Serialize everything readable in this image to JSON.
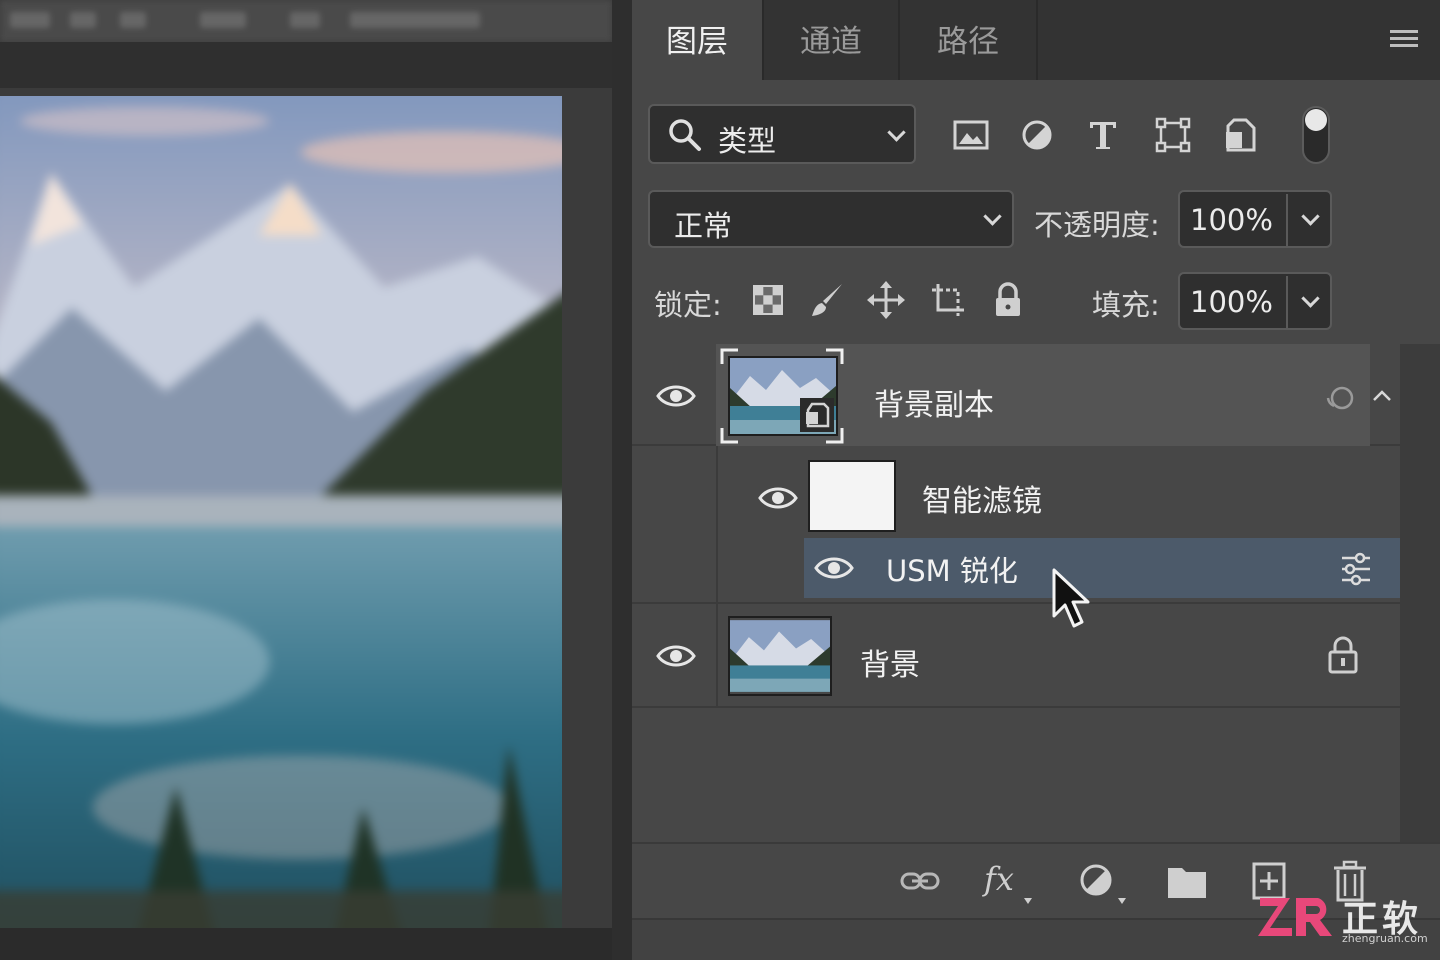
{
  "layers_panel": {
    "tabs": [
      {
        "label": "图层",
        "active": true
      },
      {
        "label": "通道",
        "active": false
      },
      {
        "label": "路径",
        "active": false
      }
    ],
    "filter": {
      "kind_label": "类型",
      "icons": [
        "image-filter-icon",
        "adjustment-filter-icon",
        "type-filter-icon",
        "shape-filter-icon",
        "smart-object-filter-icon"
      ]
    },
    "blend_mode": "正常",
    "opacity_label": "不透明度:",
    "opacity_value": "100%",
    "lock_label": "锁定:",
    "lock_icons": [
      "lock-transparent-pixels-icon",
      "lock-image-pixels-icon",
      "lock-position-icon",
      "lock-artboard-icon",
      "lock-all-icon"
    ],
    "fill_label": "填充:",
    "fill_value": "100%",
    "layers": [
      {
        "name": "背景副本",
        "visible": true,
        "smart_object": true,
        "selected": false
      },
      {
        "name": "智能滤镜",
        "visible": true,
        "type": "smart-filters"
      },
      {
        "name": "USM 锐化",
        "visible": true,
        "type": "filter",
        "highlighted": true
      },
      {
        "name": "背景",
        "visible": true,
        "locked": true
      }
    ],
    "footer_icons": [
      "link-layers-icon",
      "fx-icon",
      "new-adjustment-icon",
      "new-group-icon",
      "new-layer-icon",
      "delete-layer-icon"
    ]
  },
  "watermark": {
    "brand": "正软",
    "domain": "zhengruan.com"
  },
  "colors": {
    "panel_bg": "#474747",
    "tab_bar_bg": "#333333",
    "field_bg": "#2f2f2f",
    "highlight_row": "#4c5a6a"
  }
}
